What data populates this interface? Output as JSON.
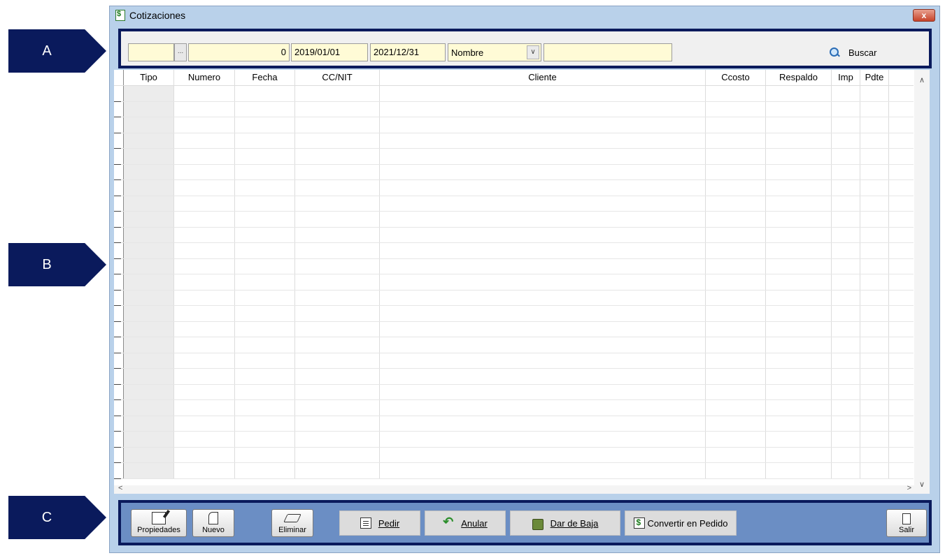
{
  "callouts": [
    "A",
    "B",
    "C"
  ],
  "window": {
    "title": "Cotizaciones",
    "close_label": "x"
  },
  "filters": {
    "code_value": "",
    "ellipsis_label": "...",
    "number_value": "0",
    "date_from": "2019/01/01",
    "date_to": "2021/12/31",
    "field_selected": "Nombre",
    "search_text": "",
    "search_label": "Buscar"
  },
  "grid": {
    "columns": [
      "Tipo",
      "Numero",
      "Fecha",
      "CC/NIT",
      "Cliente",
      "Ccosto",
      "Respaldo",
      "Imp",
      "Pdte"
    ],
    "rows": []
  },
  "toolbar": {
    "propiedades": "Propiedades",
    "nuevo": "Nuevo",
    "eliminar": "Eliminar",
    "pedir": "Pedir",
    "anular": "Anular",
    "dar_de_baja": "Dar de Baja",
    "convertir": "Convertir en Pedido",
    "salir": "Salir"
  },
  "colors": {
    "callout": "#0a1a5c",
    "field_bg": "#fffbd6",
    "toolbar_bg": "#6b8ec4",
    "window_bg": "#b9d1ea"
  }
}
